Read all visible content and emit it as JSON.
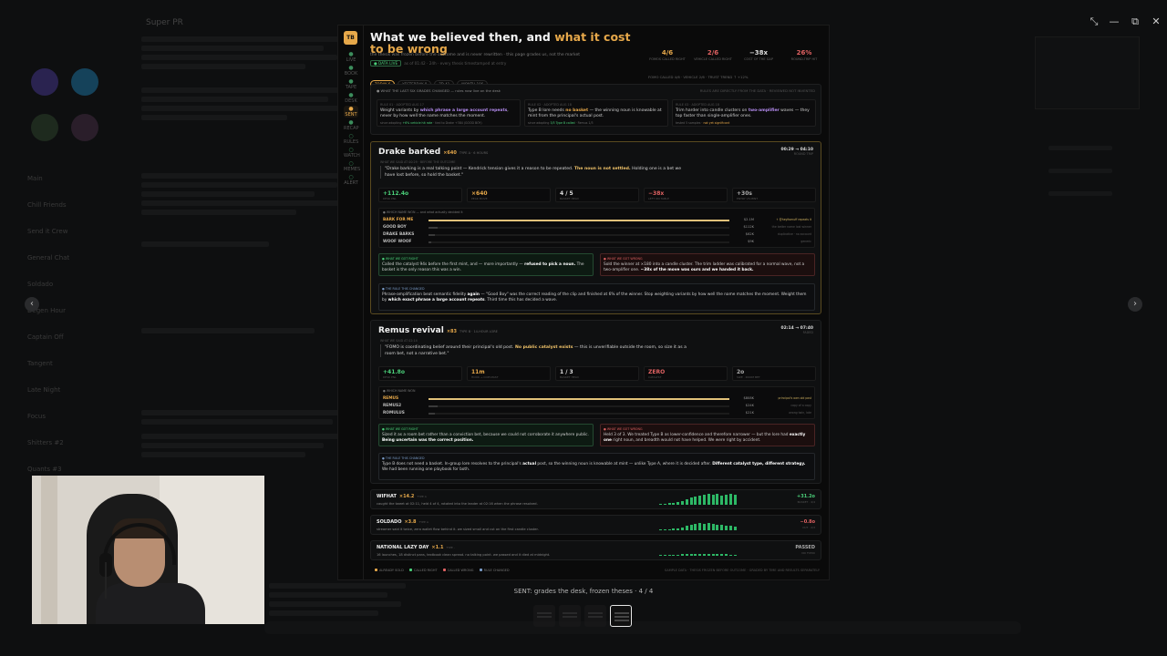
{
  "background": {
    "title": "Super PR",
    "rail_items": [
      "Main",
      "Chill Friends",
      "Send it Crew",
      "General Chat",
      "Soldado",
      "Degen Hour",
      "Captain Off",
      "Tangent",
      "Late Night",
      "Focus",
      "Shitters #2",
      "Quants #3"
    ],
    "composer_placeholder": ""
  },
  "window_controls": {
    "shrink": "⤡",
    "minimize": "—",
    "maximize": "⧉",
    "close": "✕"
  },
  "nav": {
    "prev": "‹",
    "next": "›"
  },
  "doc": {
    "logo": "TB",
    "rail": [
      {
        "icon": "●",
        "label": "LIVE"
      },
      {
        "icon": "●",
        "label": "BOOK"
      },
      {
        "icon": "●",
        "label": "TAPE"
      },
      {
        "icon": "●",
        "label": "DESK"
      },
      {
        "icon": "●",
        "label": "SENT"
      },
      {
        "icon": "●",
        "label": "RECAP"
      },
      {
        "icon": "○",
        "label": "RULES"
      },
      {
        "icon": "○",
        "label": "WATCH"
      },
      {
        "icon": "○",
        "label": "MEMES"
      },
      {
        "icon": "○",
        "label": "ALERT"
      }
    ],
    "title_a": "What we believed then, and ",
    "title_b": "what it cost to be wrong",
    "subtitle": "the thesis was frozen before the outcome and is never rewritten · this page grades us, not the market",
    "live_badge": "● DATA LIVE",
    "meta": "as of 01:42 · 24h · every thesis timestamped at entry",
    "chips": [
      {
        "label": "TODAY 6",
        "on": true
      },
      {
        "label": "YESTERDAY 8",
        "on": false
      },
      {
        "label": "7D 41",
        "on": false
      },
      {
        "label": "MONTH 186",
        "on": false
      }
    ],
    "kpis": [
      {
        "value": "4/6",
        "label": "FOMOS CALLED RIGHT",
        "color": "#e6a84a"
      },
      {
        "value": "2/6",
        "label": "VEHICLE CALLED RIGHT",
        "color": "#e06262"
      },
      {
        "value": "−38x",
        "label": "COST OF THE GAP",
        "color": "#dddddd"
      },
      {
        "value": "26%",
        "label": "ROUND-TRIP HIT",
        "color": "#e06262"
      }
    ],
    "kpi_footer": "FOMO CALLED 4/6 · VEHICLE 2/6 · TRUST TREND ↑ +12%",
    "changes": {
      "label": "● WHAT THE LAST SIX GRADES CHANGED — rules now live on the desk",
      "right": "RULES ARE DIRECTLY FROM THE DATA · REVIEWED NOT INVENTED",
      "boxes": [
        {
          "head": "RULE 01 · ADOPTED AUG 17",
          "text_a": "Weight variants by ",
          "text_b": "which phrase a large account repeats",
          "text_c": ", never by how well the name matches the moment.",
          "foot_a": "since adopting ",
          "foot_b": "+6% vehicle hit rate",
          "foot_c": " · tied to Drake +384 (GOOD BOY)"
        },
        {
          "head": "RULE 02 · ADOPTED AUG 18",
          "text_a": "Type B lore needs ",
          "text_b": "no basket",
          "text_c": " — the winning noun is knowable at mint from the principal's actual post.",
          "foot_a": "since adopting ",
          "foot_b": "3/3 Type B called",
          "foot_c": " · Remus 1/3"
        },
        {
          "head": "RULE 03 · ADOPTED AUG 18",
          "text_a": "Trim harder into candle clusters on ",
          "text_b": "two-amplifier",
          "text_c": " waves — they top faster than single-amplifier ones.",
          "foot_a": "tested 5 samples · ",
          "foot_b": "not yet significant",
          "foot_c": ""
        }
      ]
    },
    "drake": {
      "name": "Drake barked",
      "mult": "×640",
      "sub": "TYPE A · 6 HOURS",
      "time": "00:29 → 04:10",
      "time_sub": "ROUND TRIP",
      "thesis_label": "WHAT WE SAID AT 00:29 · BEFORE THE OUTCOME",
      "thesis_a": "\"Drake barking is a real talking point — Kendrick tension gives it a reason to be repeated. ",
      "thesis_b": "The noun is not settled.",
      "thesis_c": " Holding one is a bet we have lost before, so hold the basket.\"",
      "stats": [
        {
          "value": "+112.4o",
          "label": "DESK PNL",
          "color": "#4bd07a"
        },
        {
          "value": "×640",
          "label": "PEAK MOVE",
          "color": "#e6a84a"
        },
        {
          "value": "4 / 5",
          "label": "BASKET HELD",
          "color": "#dddddd"
        },
        {
          "value": "−38x",
          "label": "LEFT ON TABLE",
          "color": "#e06262"
        },
        {
          "value": "+30s",
          "label": "ENTRY VS MINT",
          "color": "#aaaaaa"
        }
      ],
      "stack_label": "● WHICH NAME WON — and what actually decided it",
      "rows": [
        {
          "name": "BARK FOR ME",
          "pct": 100,
          "amt": "$2.1M",
          "note": "↑ @heyitsmuff repeats it",
          "win": true
        },
        {
          "name": "GOOD BOY",
          "pct": 3,
          "amt": "$112K",
          "note": "the better name lost winner",
          "win": false
        },
        {
          "name": "DRAKE BARKS",
          "pct": 2,
          "amt": "$62K",
          "note": "duplicative · no account",
          "win": false
        },
        {
          "name": "WOOF WOOF",
          "pct": 1,
          "amt": "$9K",
          "note": "generic",
          "win": false
        }
      ],
      "right_head": "● WHAT WE GOT RIGHT",
      "right_a": "Called the catalyst 94s before the first mint, and — more importantly — ",
      "right_b": "refused to pick a noun.",
      "right_c": " The basket is the only reason this was a win.",
      "wrong_head": "● WHAT WE GOT WRONG",
      "wrong_a": "Sold the winner at ×180 into a candle cluster. The trim ladder was calibrated for a normal wave, not a two-amplifier one. ",
      "wrong_b": "~38x of the move was ours and we handed it back.",
      "wrong_c": "",
      "rule_head": "● THE RULE THIS CHANGED",
      "rule_a": "Phrase-amplification beat semantic fidelity ",
      "rule_b": "again",
      "rule_c": " — \"Good Boy\" was the correct reading of the clip and finished at 6% of the winner. Stop weighting variants by how well the name matches the moment. Weight them by ",
      "rule_d": "which exact phrase a large account repeats",
      "rule_e": ". Third time this has decided a wave."
    },
    "remus": {
      "name": "Remus revival",
      "mult": "×83",
      "sub": "TYPE B · 14-HOUR LORE",
      "time": "02:14 → 07:40",
      "time_sub": "FADED",
      "thesis_label": "WHAT WE SAID AT 02:14",
      "thesis_a": "\"FOMO is coordinating belief around their principal's old post. ",
      "thesis_b": "No public catalyst exists",
      "thesis_c": " — this is unverifiable outside the room, so size it as a room bet, not a narrative bet.\"",
      "stats": [
        {
          "value": "+41.8o",
          "label": "DESK PNL",
          "color": "#4bd07a"
        },
        {
          "value": "11m",
          "label": "HOOK → COPY-PAST",
          "color": "#e6a84a"
        },
        {
          "value": "1 / 3",
          "label": "BASKET HELD",
          "color": "#dddddd"
        },
        {
          "value": "ZERO",
          "label": "CATALYST",
          "color": "#e06262"
        },
        {
          "value": "2o",
          "label": "SIZE · ROOM BET",
          "color": "#aaaaaa"
        }
      ],
      "stack_label": "● WHICH NAME WON",
      "rows": [
        {
          "name": "REMUS",
          "pct": 100,
          "amt": "$808K",
          "note": "principal's own old post",
          "win": true
        },
        {
          "name": "REMUS2",
          "pct": 3,
          "amt": "$24K",
          "note": "copy of a copy",
          "win": false
        },
        {
          "name": "ROMULUS",
          "pct": 2,
          "amt": "$21K",
          "note": "wrong twin, late",
          "win": false
        }
      ],
      "right_head": "● WHAT WE GOT RIGHT",
      "right_a": "Sized it as a room bet rather than a conviction bet, because we could not corroborate it anywhere public. ",
      "right_b": "Being uncertain was the correct position.",
      "right_c": "",
      "wrong_head": "● WHAT WE GOT WRONG",
      "wrong_a": "Held 3 of 3. We treated Type B as lower-confidence and therefore narrower — but the lore had ",
      "wrong_b": "exactly one",
      "wrong_c": " right noun, and breadth would not have helped. We were right by accident.",
      "rule_head": "● THE RULE THIS CHANGED",
      "rule_a": "Type B does not need a basket. In-group lore resolves to the principal's ",
      "rule_b": "actual",
      "rule_c": " post, so the winning noun is knowable at mint — unlike Type A, where it is decided after. ",
      "rule_d": "Different catalyst type, different strategy.",
      "rule_e": " We had been running one playbook for both."
    },
    "small_cases": [
      {
        "name": "WIFHAT",
        "mult": "×14.2",
        "sub": "TYPE A",
        "desc": "caught the tweet at 02:11, held 4 of 4, rotated into the leader at 02:16 when the phrase resolved.",
        "result": "+31.2o",
        "result_sub": "BASKET · 4/4",
        "color": "#4bd07a"
      },
      {
        "name": "SOLDADO",
        "mult": "×3.8",
        "sub": "TYPE A",
        "desc": "streamer said it twice, zero wallet flow behind it. we sized small and cut on the first candle cluster.",
        "result": "−0.8o",
        "result_sub": "CUT · 2/3",
        "color": "#e06262"
      },
      {
        "name": "NATIONAL LAZY DAY",
        "mult": "×1.1",
        "sub": "TYPE -",
        "desc": "16 launches, 18 distinct pans, textbook clean spread. no talking point. we passed and it died at midnight.",
        "result": "PASSED",
        "result_sub": "NO FOMO",
        "color": "#aaaaaa"
      }
    ],
    "legend": [
      {
        "label": "ALREADY SOLD",
        "color": "#e6a84a"
      },
      {
        "label": "CALLED RIGHT",
        "color": "#4bd07a"
      },
      {
        "label": "CALLED WRONG",
        "color": "#e06262"
      },
      {
        "label": "RULE CHANGED",
        "color": "#7a9cc8"
      }
    ],
    "legend_right": "SAMPLE DATA · THESIS FROZEN BEFORE OUTCOME · GRADED BY TIME AND RESULTS SEPARATELY"
  },
  "caption": "SENT: grades the desk, frozen theses · 4 / 4"
}
